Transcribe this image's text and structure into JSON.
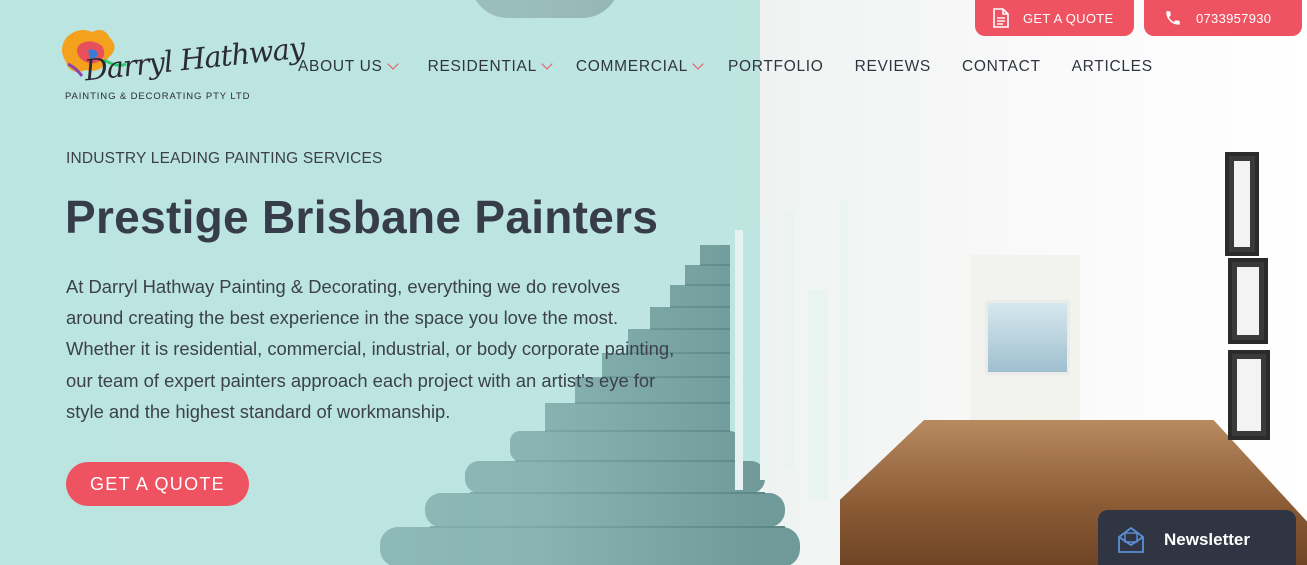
{
  "brand": {
    "script_name": "Darryl Hathway",
    "subtitle": "PAINTING & DECORATING PTY LTD"
  },
  "top_buttons": {
    "quote_label": "GET A QUOTE",
    "phone_label": "0733957930"
  },
  "nav": {
    "items": [
      {
        "label": "ABOUT US",
        "has_dropdown": true
      },
      {
        "label": "RESIDENTIAL",
        "has_dropdown": true
      },
      {
        "label": "COMMERCIAL",
        "has_dropdown": true
      },
      {
        "label": "PORTFOLIO",
        "has_dropdown": false
      },
      {
        "label": "REVIEWS",
        "has_dropdown": false
      },
      {
        "label": "CONTACT",
        "has_dropdown": false
      },
      {
        "label": "ARTICLES",
        "has_dropdown": false
      }
    ]
  },
  "hero": {
    "eyebrow": "INDUSTRY LEADING PAINTING SERVICES",
    "headline": "Prestige Brisbane Painters",
    "body": "At Darryl Hathway Painting & Decorating, everything we do revolves around creating the best experience in the space you love the most. Whether it is residential, commercial, industrial, or body corporate painting, our team of expert painters approach each project with an artist's eye for style and the highest standard of workmanship.",
    "cta_label": "GET A QUOTE"
  },
  "newsletter": {
    "label": "Newsletter",
    "icon": "mail-icon"
  },
  "colors": {
    "accent": "#ef5361",
    "text_dark": "#363c48",
    "hero_tint": "#bfe5e1",
    "newsletter_bg": "#2f3542"
  }
}
